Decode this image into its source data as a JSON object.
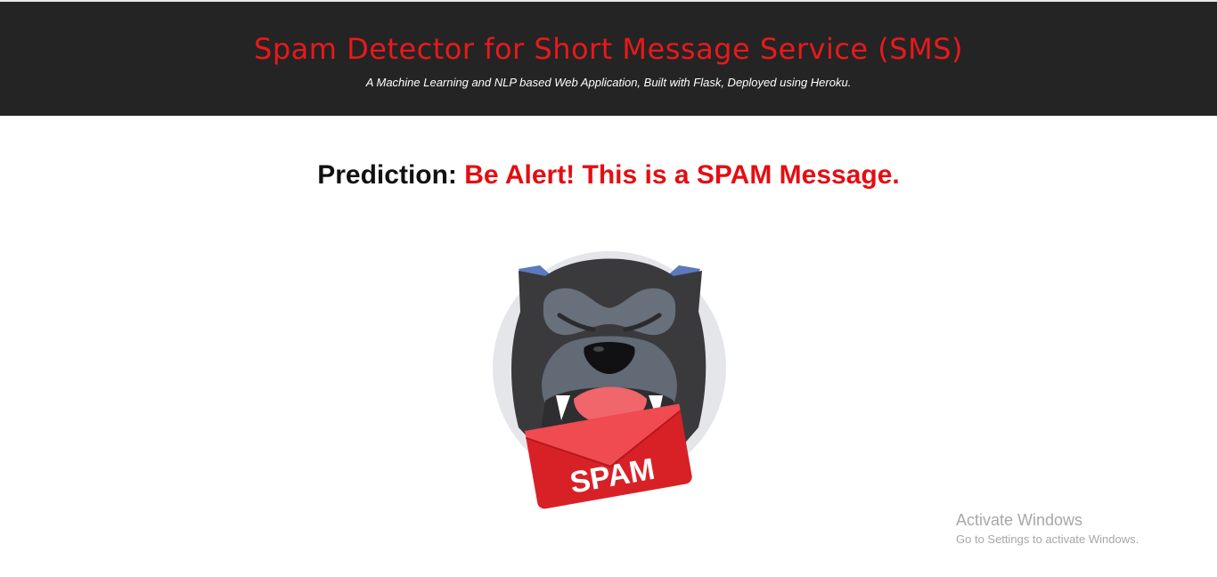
{
  "header": {
    "title": "Spam Detector for Short Message Service (SMS)",
    "subtitle": "A Machine Learning and NLP based Web Application, Built with Flask, Deployed using Heroku."
  },
  "prediction": {
    "label": "Prediction:",
    "result": "Be Alert! This is a SPAM Message."
  },
  "illustration": {
    "badge_text": "SPAM"
  },
  "watermark": {
    "title": "Activate Windows",
    "subtitle": "Go to Settings to activate Windows."
  },
  "colors": {
    "header_bg": "#242424",
    "title": "#e8191c",
    "result": "#e50d12"
  }
}
